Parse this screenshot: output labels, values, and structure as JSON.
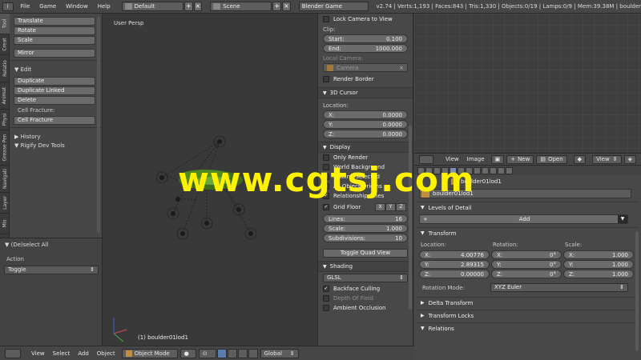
{
  "topbar": {
    "menus": [
      "File",
      "Game",
      "Window",
      "Help"
    ],
    "layout": "Default",
    "scene": "Scene",
    "engine": "Blender Game",
    "stats": "v2.74 | Verts:1,193 | Faces:843 | Tris:1,330 | Objects:0/19 | Lamps:0/9 | Mem:39.38M | boulder"
  },
  "tool_tabs": [
    "Tool",
    "Creat",
    "Relatio",
    "Animat",
    "Physi",
    "Grease Pen",
    "Navigati",
    "Layer",
    "Mis"
  ],
  "tool_panel": {
    "transform_buttons": [
      "Translate",
      "Rotate",
      "Scale"
    ],
    "mirror": "Mirror",
    "edit_header": "Edit",
    "edit_buttons": [
      "Duplicate",
      "Duplicate Linked",
      "Delete"
    ],
    "cell_fracture_label": "Cell Fracture:",
    "cell_fracture_button": "Cell Fracture",
    "history": "History",
    "rigify": "Rigify Dev Tools"
  },
  "operator_panel": {
    "title": "(De)select All",
    "action_label": "Action",
    "action_value": "Toggle"
  },
  "viewport": {
    "label": "User Persp",
    "object": "(1) boulder01lod1"
  },
  "npanel": {
    "lock_camera": "Lock Camera to View",
    "clip_label": "Clip:",
    "clip_start_label": "Start:",
    "clip_start": "0.100",
    "clip_end_label": "End:",
    "clip_end": "1000.000",
    "local_camera_label": "Local Camera:",
    "local_camera": "Camera",
    "render_border": "Render Border",
    "cursor_header": "3D Cursor",
    "location_label": "Location:",
    "cursor_x_label": "X:",
    "cursor_x": "0.0000",
    "cursor_y_label": "Y:",
    "cursor_y": "0.0000",
    "cursor_z_label": "Z:",
    "cursor_z": "0.0000",
    "display_header": "Display",
    "only_render": "Only Render",
    "world_background": "World Background",
    "outline_selected": "Outline Selected",
    "all_object_origins": "All Object Origins",
    "relationship_lines": "Relationship Lines",
    "grid_floor": "Grid Floor",
    "axes": [
      "X",
      "Y",
      "Z"
    ],
    "lines_label": "Lines:",
    "lines": "16",
    "scale_label": "Scale:",
    "scale": "1.000",
    "subdiv_label": "Subdivisions:",
    "subdiv": "10",
    "toggle_quad": "Toggle Quad View",
    "shading_header": "Shading",
    "shading_mode": "GLSL",
    "backface_culling": "Backface Culling",
    "depth_of_field": "Depth Of Field",
    "ambient_occlusion": "Ambient Occlusion"
  },
  "image_header": {
    "menus": [
      "View",
      "Image"
    ],
    "new": "New",
    "open": "Open",
    "view": "View"
  },
  "properties": {
    "object_name": "boulder01lod1",
    "lod_header": "Levels of Detail",
    "add": "Add",
    "transform_header": "Transform",
    "location_label": "Location:",
    "rotation_label": "Rotation:",
    "scale_label": "Scale:",
    "loc": [
      [
        "X:",
        "4.00776"
      ],
      [
        "Y:",
        "2.89315"
      ],
      [
        "Z:",
        "0.00000"
      ]
    ],
    "rot": [
      [
        "X:",
        "0°"
      ],
      [
        "Y:",
        "0°"
      ],
      [
        "Z:",
        "0°"
      ]
    ],
    "scl": [
      [
        "X:",
        "1.000"
      ],
      [
        "Y:",
        "1.000"
      ],
      [
        "Z:",
        "1.000"
      ]
    ],
    "rotation_mode_label": "Rotation Mode:",
    "rotation_mode": "XYZ Euler",
    "delta_header": "Delta Transform",
    "locks_header": "Transform Locks",
    "relations_header": "Relations"
  },
  "bottombar": {
    "menus": [
      "View",
      "Select",
      "Add",
      "Object"
    ],
    "mode": "Object Mode",
    "orientation": "Global"
  },
  "watermark": "www.cgtsj.com"
}
